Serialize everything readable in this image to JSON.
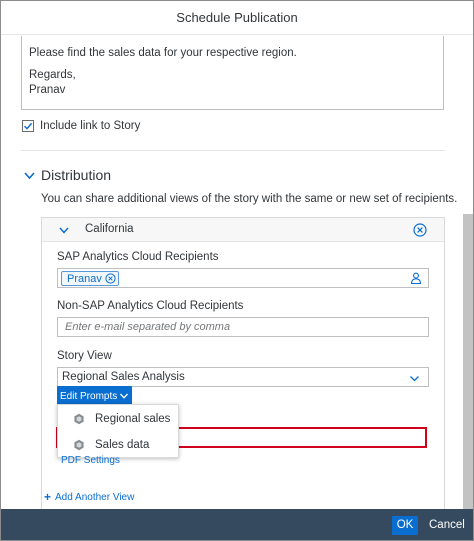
{
  "dialog": {
    "title": "Schedule Publication"
  },
  "message": {
    "line1": "Please find the sales data for your respective region.",
    "line2": "Regards,",
    "line3": "Pranav"
  },
  "include_link": {
    "label": "Include link to Story",
    "checked": true
  },
  "distribution": {
    "title": "Distribution",
    "description": "You can share additional views of the story with the same or new set of recipients."
  },
  "view_panel": {
    "region": "California",
    "sac_recipients_label": "SAP Analytics Cloud Recipients",
    "recipient_token": "Pranav",
    "non_sac_label": "Non-SAP Analytics Cloud Recipients",
    "non_sac_placeholder": "Enter e-mail separated by comma",
    "story_view_label": "Story View",
    "story_view_value": "Regional Sales Analysis",
    "edit_prompts_label": "Edit Prompts"
  },
  "prompt_menu": {
    "items": [
      {
        "label": "Regional sales",
        "icon": "model-icon"
      },
      {
        "label": "Sales data",
        "icon": "model-icon"
      }
    ]
  },
  "pdf_settings_label": "PDF Settings",
  "add_view_label": "Add Another View",
  "footer": {
    "ok_label": "OK",
    "cancel_label": "Cancel"
  },
  "colors": {
    "accent": "#0a6ed1",
    "footer_bg": "#354a5f",
    "error_border": "#d0021b"
  }
}
